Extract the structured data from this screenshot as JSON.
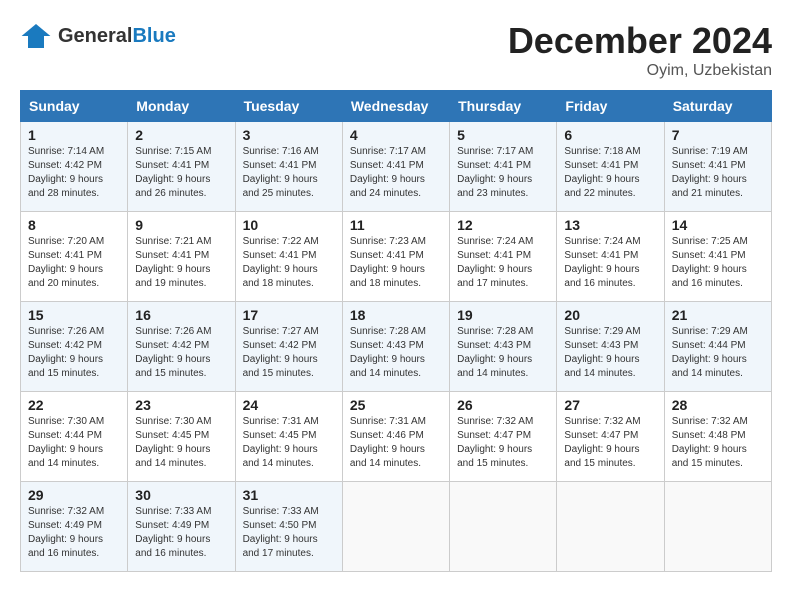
{
  "header": {
    "logo_general": "General",
    "logo_blue": "Blue",
    "month_title": "December 2024",
    "location": "Oyim, Uzbekistan"
  },
  "days_of_week": [
    "Sunday",
    "Monday",
    "Tuesday",
    "Wednesday",
    "Thursday",
    "Friday",
    "Saturday"
  ],
  "weeks": [
    [
      {
        "day": "1",
        "sunrise": "7:14 AM",
        "sunset": "4:42 PM",
        "daylight": "9 hours and 28 minutes."
      },
      {
        "day": "2",
        "sunrise": "7:15 AM",
        "sunset": "4:41 PM",
        "daylight": "9 hours and 26 minutes."
      },
      {
        "day": "3",
        "sunrise": "7:16 AM",
        "sunset": "4:41 PM",
        "daylight": "9 hours and 25 minutes."
      },
      {
        "day": "4",
        "sunrise": "7:17 AM",
        "sunset": "4:41 PM",
        "daylight": "9 hours and 24 minutes."
      },
      {
        "day": "5",
        "sunrise": "7:17 AM",
        "sunset": "4:41 PM",
        "daylight": "9 hours and 23 minutes."
      },
      {
        "day": "6",
        "sunrise": "7:18 AM",
        "sunset": "4:41 PM",
        "daylight": "9 hours and 22 minutes."
      },
      {
        "day": "7",
        "sunrise": "7:19 AM",
        "sunset": "4:41 PM",
        "daylight": "9 hours and 21 minutes."
      }
    ],
    [
      {
        "day": "8",
        "sunrise": "7:20 AM",
        "sunset": "4:41 PM",
        "daylight": "9 hours and 20 minutes."
      },
      {
        "day": "9",
        "sunrise": "7:21 AM",
        "sunset": "4:41 PM",
        "daylight": "9 hours and 19 minutes."
      },
      {
        "day": "10",
        "sunrise": "7:22 AM",
        "sunset": "4:41 PM",
        "daylight": "9 hours and 18 minutes."
      },
      {
        "day": "11",
        "sunrise": "7:23 AM",
        "sunset": "4:41 PM",
        "daylight": "9 hours and 18 minutes."
      },
      {
        "day": "12",
        "sunrise": "7:24 AM",
        "sunset": "4:41 PM",
        "daylight": "9 hours and 17 minutes."
      },
      {
        "day": "13",
        "sunrise": "7:24 AM",
        "sunset": "4:41 PM",
        "daylight": "9 hours and 16 minutes."
      },
      {
        "day": "14",
        "sunrise": "7:25 AM",
        "sunset": "4:41 PM",
        "daylight": "9 hours and 16 minutes."
      }
    ],
    [
      {
        "day": "15",
        "sunrise": "7:26 AM",
        "sunset": "4:42 PM",
        "daylight": "9 hours and 15 minutes."
      },
      {
        "day": "16",
        "sunrise": "7:26 AM",
        "sunset": "4:42 PM",
        "daylight": "9 hours and 15 minutes."
      },
      {
        "day": "17",
        "sunrise": "7:27 AM",
        "sunset": "4:42 PM",
        "daylight": "9 hours and 15 minutes."
      },
      {
        "day": "18",
        "sunrise": "7:28 AM",
        "sunset": "4:43 PM",
        "daylight": "9 hours and 14 minutes."
      },
      {
        "day": "19",
        "sunrise": "7:28 AM",
        "sunset": "4:43 PM",
        "daylight": "9 hours and 14 minutes."
      },
      {
        "day": "20",
        "sunrise": "7:29 AM",
        "sunset": "4:43 PM",
        "daylight": "9 hours and 14 minutes."
      },
      {
        "day": "21",
        "sunrise": "7:29 AM",
        "sunset": "4:44 PM",
        "daylight": "9 hours and 14 minutes."
      }
    ],
    [
      {
        "day": "22",
        "sunrise": "7:30 AM",
        "sunset": "4:44 PM",
        "daylight": "9 hours and 14 minutes."
      },
      {
        "day": "23",
        "sunrise": "7:30 AM",
        "sunset": "4:45 PM",
        "daylight": "9 hours and 14 minutes."
      },
      {
        "day": "24",
        "sunrise": "7:31 AM",
        "sunset": "4:45 PM",
        "daylight": "9 hours and 14 minutes."
      },
      {
        "day": "25",
        "sunrise": "7:31 AM",
        "sunset": "4:46 PM",
        "daylight": "9 hours and 14 minutes."
      },
      {
        "day": "26",
        "sunrise": "7:32 AM",
        "sunset": "4:47 PM",
        "daylight": "9 hours and 15 minutes."
      },
      {
        "day": "27",
        "sunrise": "7:32 AM",
        "sunset": "4:47 PM",
        "daylight": "9 hours and 15 minutes."
      },
      {
        "day": "28",
        "sunrise": "7:32 AM",
        "sunset": "4:48 PM",
        "daylight": "9 hours and 15 minutes."
      }
    ],
    [
      {
        "day": "29",
        "sunrise": "7:32 AM",
        "sunset": "4:49 PM",
        "daylight": "9 hours and 16 minutes."
      },
      {
        "day": "30",
        "sunrise": "7:33 AM",
        "sunset": "4:49 PM",
        "daylight": "9 hours and 16 minutes."
      },
      {
        "day": "31",
        "sunrise": "7:33 AM",
        "sunset": "4:50 PM",
        "daylight": "9 hours and 17 minutes."
      },
      null,
      null,
      null,
      null
    ]
  ],
  "labels": {
    "sunrise": "Sunrise:",
    "sunset": "Sunset:",
    "daylight": "Daylight:"
  }
}
